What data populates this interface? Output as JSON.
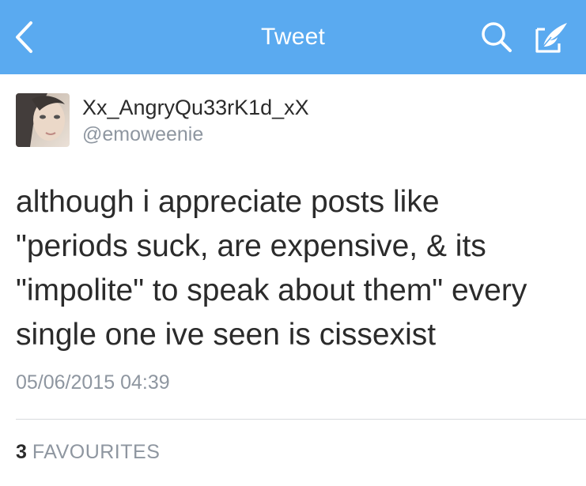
{
  "navbar": {
    "title": "Tweet",
    "back_icon": "chevron-left-icon",
    "search_icon": "search-icon",
    "compose_icon": "compose-tweet-icon",
    "background_color": "#5aaaf0"
  },
  "tweet": {
    "author": {
      "display_name": "Xx_AngryQu33rK1d_xX",
      "handle": "@emoweenie"
    },
    "text_lines": [
      "although i appreciate posts like",
      "\"periods suck, are expensive, & its",
      "\"impolite\" to speak about them\" every",
      "single one ive seen is cissexist"
    ],
    "timestamp": "05/06/2015 04:39",
    "stats": {
      "favourites_count": "3",
      "favourites_label": "FAVOURITES"
    }
  }
}
